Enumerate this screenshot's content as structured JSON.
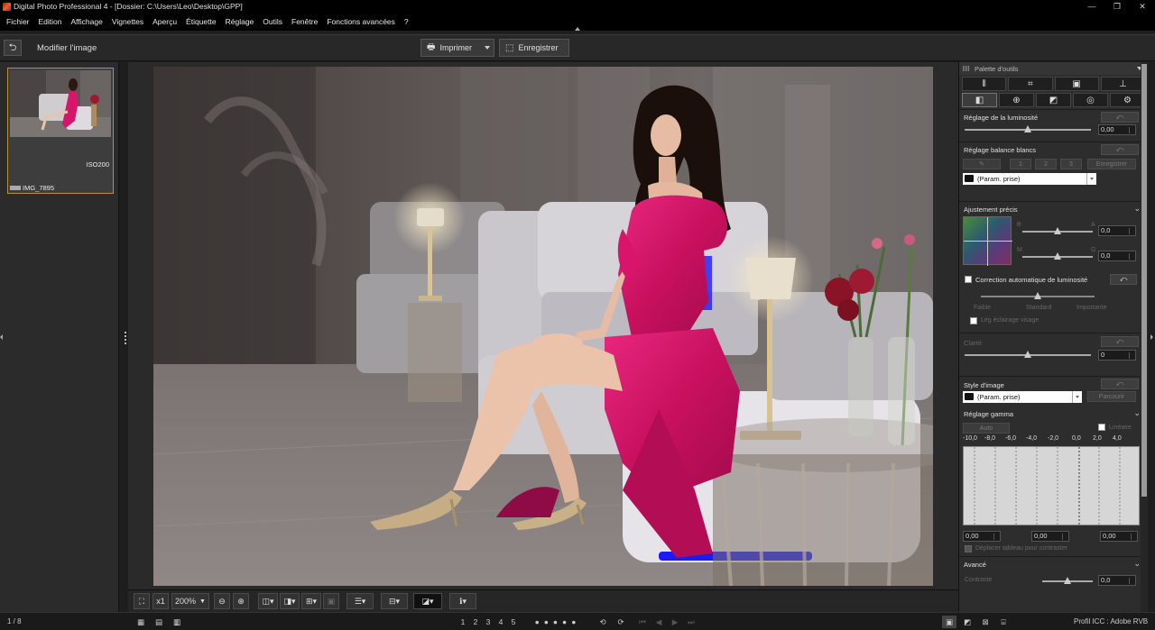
{
  "window": {
    "title": "Digital Photo Professional 4 - [Dossier: C:\\Users\\Leo\\Desktop\\GPP]",
    "controls": [
      "—",
      "❐",
      "✕"
    ]
  },
  "menu": [
    "Fichier",
    "Edition",
    "Affichage",
    "Vignettes",
    "Aperçu",
    "Étiquette",
    "Réglage",
    "Outils",
    "Fenêtre",
    "Fonctions avancées",
    "?"
  ],
  "toolbar": {
    "back_icon": "⮌",
    "mode_label": "Modifier l'image",
    "print_label": "Imprimer",
    "print_icon": "🖶",
    "save_label": "Enregistrer",
    "save_icon": "⬚"
  },
  "thumbnail": {
    "iso": "ISO200",
    "filename": "IMG_7895"
  },
  "viewbar": {
    "fit_icon": "⛶",
    "zoom_1": "x1",
    "zoom_level": "200%",
    "zoom_out": "⊖",
    "zoom_in": "⊕"
  },
  "palette": {
    "header": "Palette d'outils",
    "tabs_top": [
      "⫴",
      "⌗",
      "▣",
      "⊥"
    ],
    "tabs_bottom": [
      "◧",
      "⊕",
      "◩",
      "◎",
      "⚙"
    ],
    "brightness": {
      "title": "Réglage de la luminosité",
      "value": "0,00"
    },
    "white_balance": {
      "title": "Réglage balance blancs",
      "btn1": "1",
      "btn2": "2",
      "btn3": "3",
      "register": "Enregistrer",
      "preset": "(Param. prise)"
    },
    "fine_adjust": {
      "title": "Ajustement précis",
      "label_b": "B",
      "label_a": "A",
      "label_m": "M",
      "label_g": "G",
      "value1": "0,0",
      "value2": "0,0"
    },
    "auto_light": {
      "title": "Correction automatique de luminosité",
      "low": "Faible",
      "standard": "Standard",
      "strong": "Importante",
      "face": "Lég éclairage visage"
    },
    "clarity": {
      "title": "Clarté",
      "value": "0"
    },
    "picture_style": {
      "title": "Style d'image",
      "preset": "(Param. prise)",
      "browse": "Parcourir"
    },
    "gamma": {
      "title": "Réglage gamma",
      "auto": "Auto",
      "linear": "Linéaire",
      "scale": [
        "-10,0",
        "-8,0",
        "-6,0",
        "-4,0",
        "-2,0",
        "0,0",
        "2,0",
        "4,0"
      ],
      "v1": "0,00",
      "v2": "0,00",
      "v3": "0,00",
      "move_curve": "Déplacer tableau pour contraster"
    },
    "advanced": {
      "title": "Avancé",
      "contrast": "Contraste",
      "contrast_value": "0,0"
    }
  },
  "status": {
    "count": "1 / 8",
    "profile": "Profil ICC : Adobe RVB",
    "stars": [
      "1",
      "2",
      "3",
      "4",
      "5"
    ]
  },
  "colors": {
    "accent_border": "#b8913a",
    "highlight_clip": "#1a1aff",
    "dress": "#d4176b"
  }
}
